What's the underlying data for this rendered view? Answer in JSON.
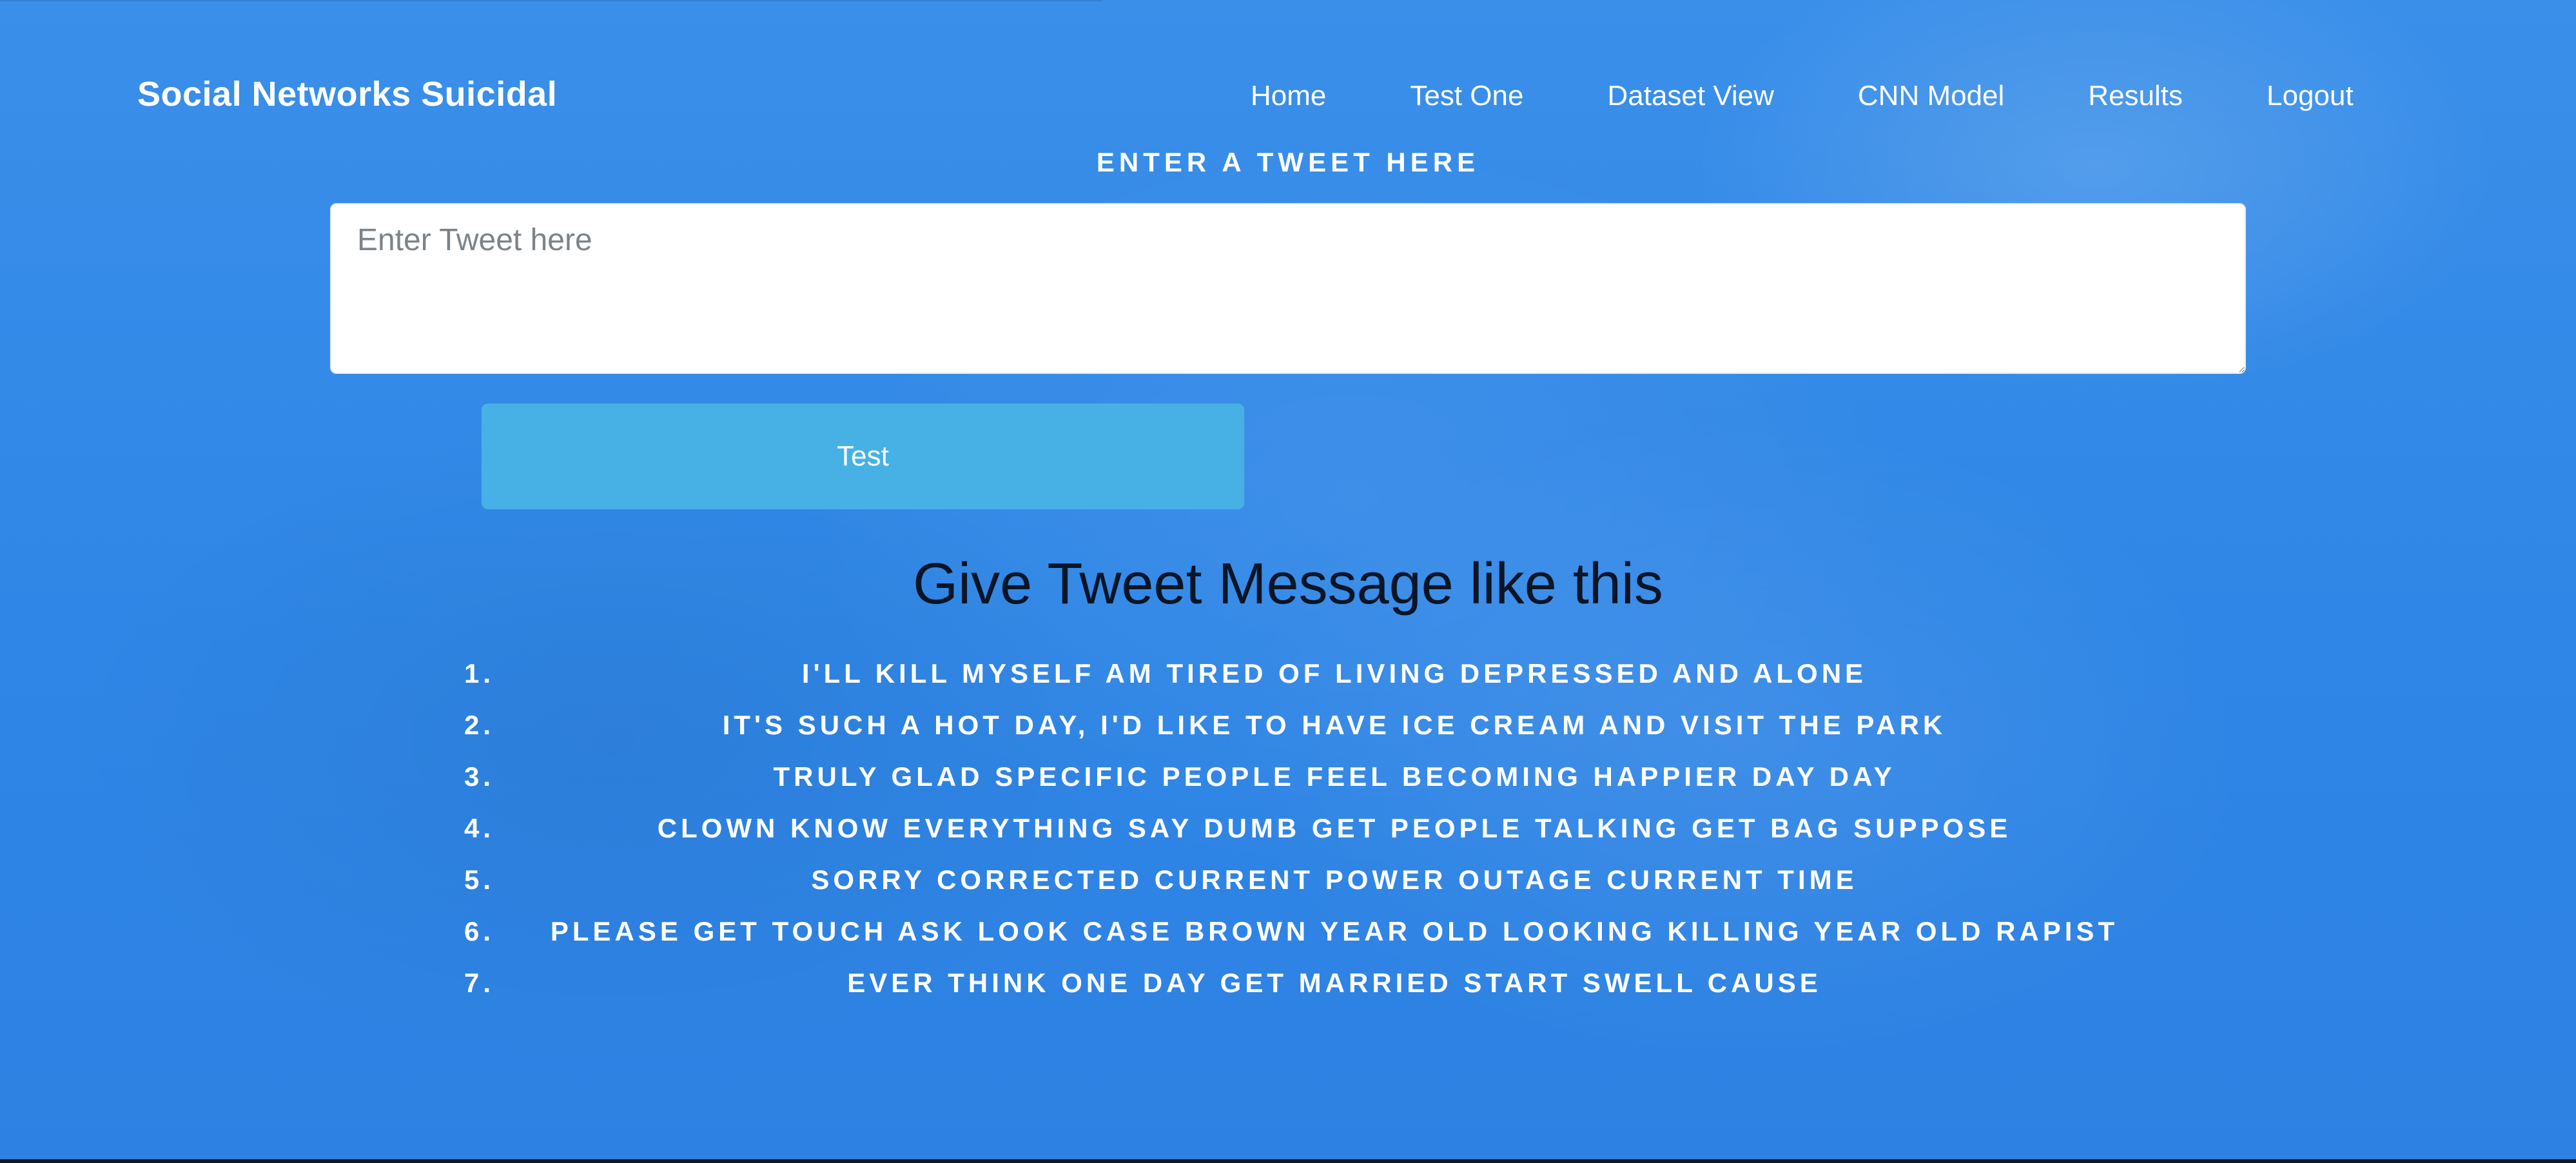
{
  "brand": {
    "title": "Social Networks Suicidal"
  },
  "nav": {
    "items": [
      {
        "label": "Home"
      },
      {
        "label": "Test One"
      },
      {
        "label": "Dataset View"
      },
      {
        "label": "CNN Model"
      },
      {
        "label": "Results"
      },
      {
        "label": "Logout"
      }
    ]
  },
  "form": {
    "label": "ENTER A TWEET HERE",
    "input_value": "",
    "input_placeholder": "Enter Tweet here",
    "button_label": "Test"
  },
  "examples": {
    "heading": "Give Tweet Message like this",
    "items": [
      {
        "num": "1.",
        "text": "I'LL KILL MYSELF AM TIRED OF LIVING DEPRESSED AND ALONE"
      },
      {
        "num": "2.",
        "text": "IT'S SUCH A HOT DAY, I'D LIKE TO HAVE ICE CREAM AND VISIT THE PARK"
      },
      {
        "num": "3.",
        "text": "TRULY GLAD SPECIFIC PEOPLE FEEL BECOMING HAPPIER DAY DAY"
      },
      {
        "num": "4.",
        "text": "CLOWN KNOW EVERYTHING SAY DUMB GET PEOPLE TALKING GET BAG SUPPOSE"
      },
      {
        "num": "5.",
        "text": "SORRY CORRECTED CURRENT POWER OUTAGE CURRENT TIME"
      },
      {
        "num": "6.",
        "text": "PLEASE GET TOUCH ASK LOOK CASE BROWN YEAR OLD LOOKING KILLING YEAR OLD RAPIST"
      },
      {
        "num": "7.",
        "text": "EVER THINK ONE DAY GET MARRIED START SWELL CAUSE"
      }
    ]
  },
  "colors": {
    "background": "#2f86e6",
    "button": "#47b1e6",
    "heading_text": "#0a1526",
    "light_text": "#ffffff"
  }
}
